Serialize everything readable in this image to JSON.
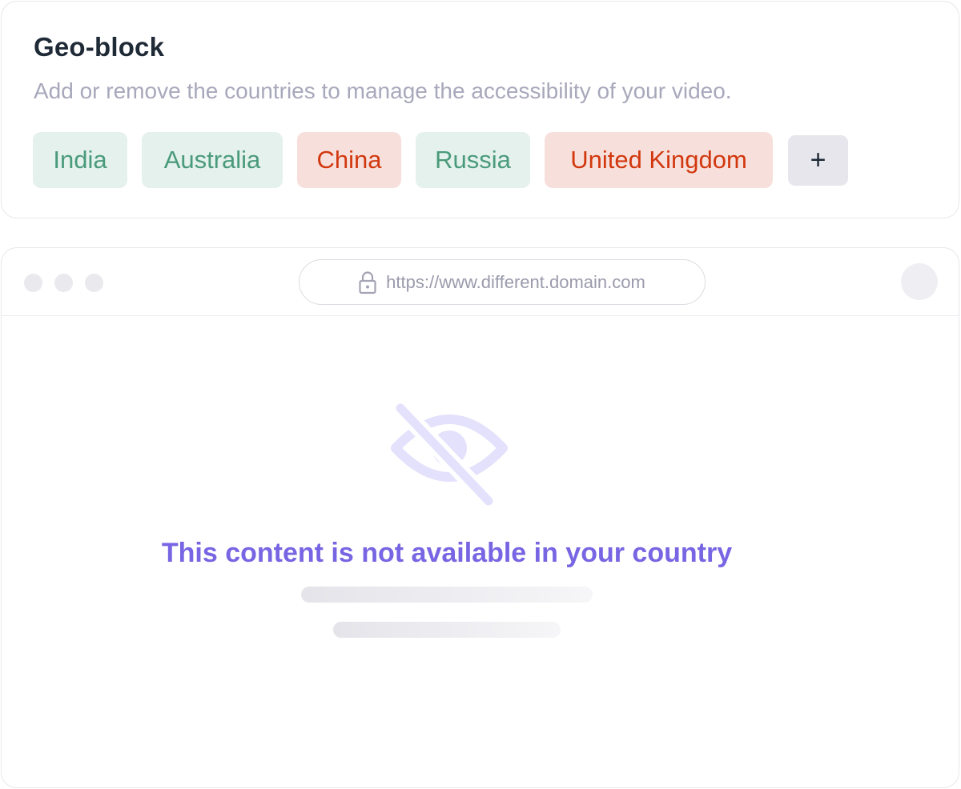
{
  "geo_block": {
    "title": "Geo-block",
    "description": "Add or remove the countries to manage the accessibility of your video.",
    "countries": [
      {
        "label": "India",
        "status": "allowed"
      },
      {
        "label": "Australia",
        "status": "allowed"
      },
      {
        "label": "China",
        "status": "blocked"
      },
      {
        "label": "Russia",
        "status": "allowed"
      },
      {
        "label": "United Kingdom",
        "status": "blocked"
      }
    ],
    "add_label": "+"
  },
  "browser": {
    "url": "https://www.different.domain.com",
    "lock_icon": "lock-icon",
    "message_icon": "eye-off-icon",
    "message": "This content is not available in your country"
  },
  "colors": {
    "allowed_bg": "#e4f1ec",
    "allowed_text": "#4a9a7c",
    "blocked_bg": "#f7e0db",
    "blocked_text": "#d2380f",
    "accent": "#7765e3"
  }
}
